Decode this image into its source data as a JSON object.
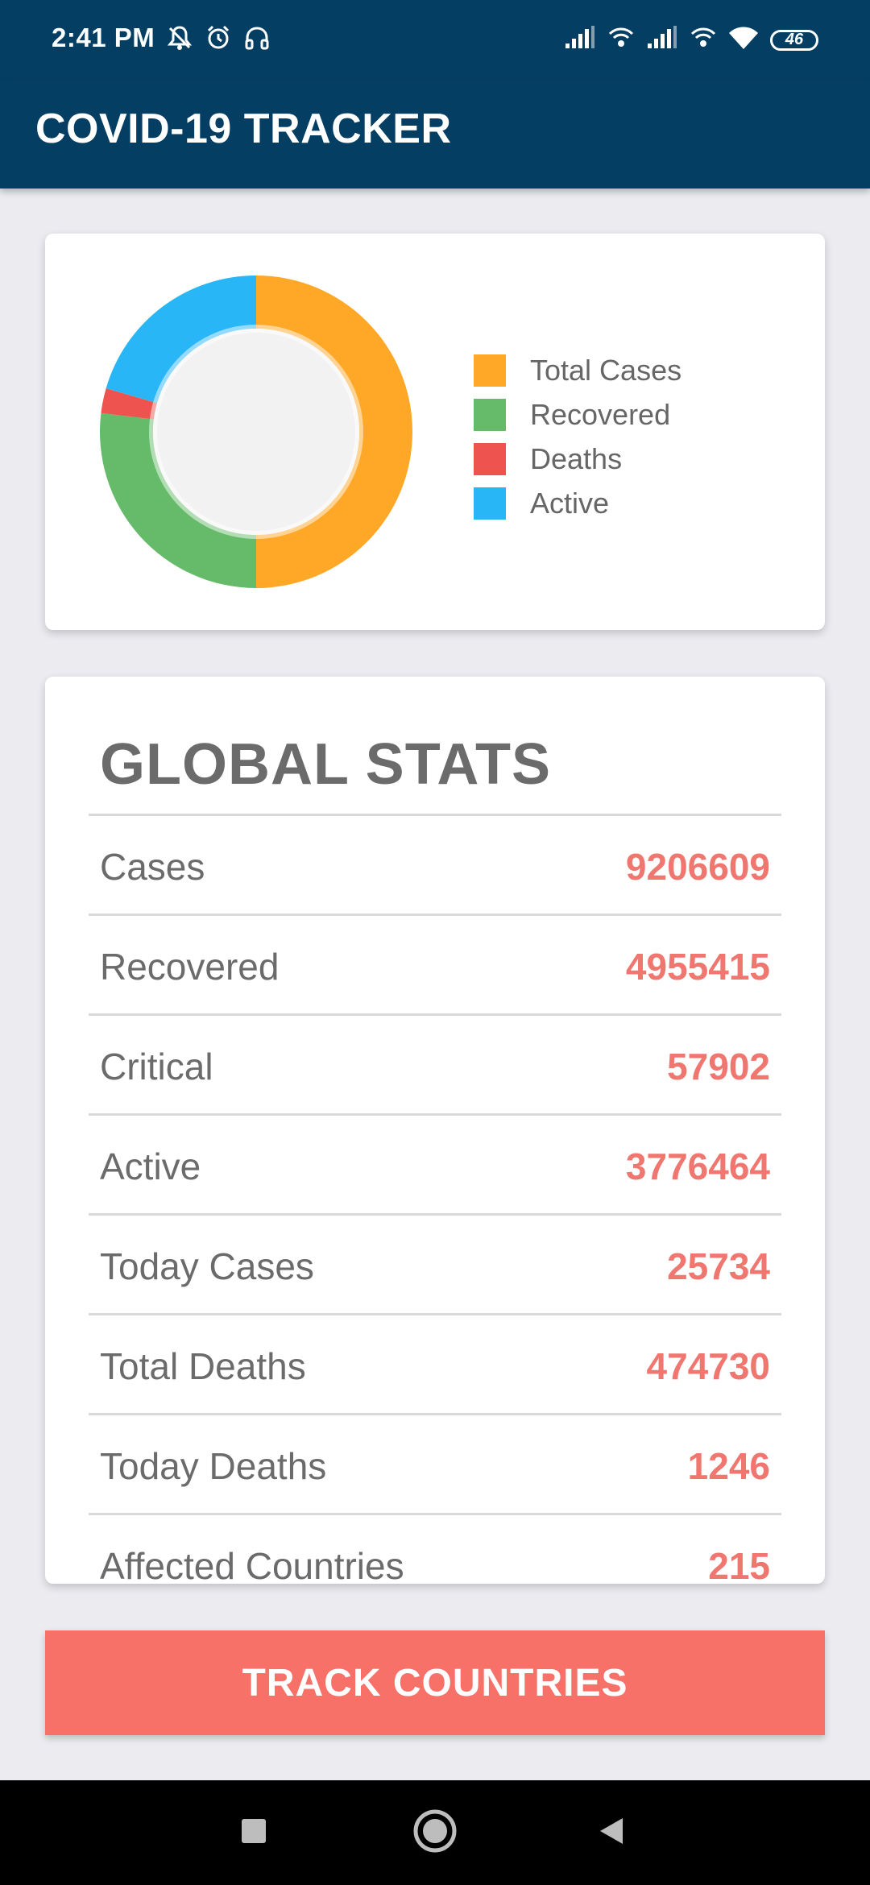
{
  "status_bar": {
    "time": "2:41 PM",
    "left_icons": [
      "muted-notification-icon",
      "alarm-icon",
      "headset-icon"
    ],
    "right_icons": [
      "signal-icon",
      "wifi-call-icon",
      "signal-icon",
      "wifi-call-icon",
      "wifi-icon"
    ],
    "battery": "46"
  },
  "toolbar": {
    "title": "COVID-19 TRACKER",
    "color": "#043f63"
  },
  "chart_data": {
    "type": "pie",
    "legend": [
      {
        "label": "Total Cases",
        "color": "#ffa726"
      },
      {
        "label": "Recovered",
        "color": "#66bb6a"
      },
      {
        "label": "Deaths",
        "color": "#ef5350"
      },
      {
        "label": "Active",
        "color": "#29b6f6"
      }
    ],
    "values": [
      9206609,
      4955415,
      474730,
      3776464
    ],
    "legend_position": "right"
  },
  "stats": {
    "title": "GLOBAL STATS",
    "rows": [
      {
        "label": "Cases",
        "value": "9206609"
      },
      {
        "label": "Recovered",
        "value": "4955415"
      },
      {
        "label": "Critical",
        "value": "57902"
      },
      {
        "label": "Active",
        "value": "3776464"
      },
      {
        "label": "Today Cases",
        "value": "25734"
      },
      {
        "label": "Total Deaths",
        "value": "474730"
      },
      {
        "label": "Today Deaths",
        "value": "1246"
      },
      {
        "label": "Affected Countries",
        "value": "215"
      }
    ]
  },
  "button": {
    "label": "TRACK COUNTRIES",
    "color": "#f87168"
  },
  "nav": {
    "icons": [
      "recents-square-icon",
      "home-circle-icon",
      "back-triangle-icon"
    ]
  }
}
